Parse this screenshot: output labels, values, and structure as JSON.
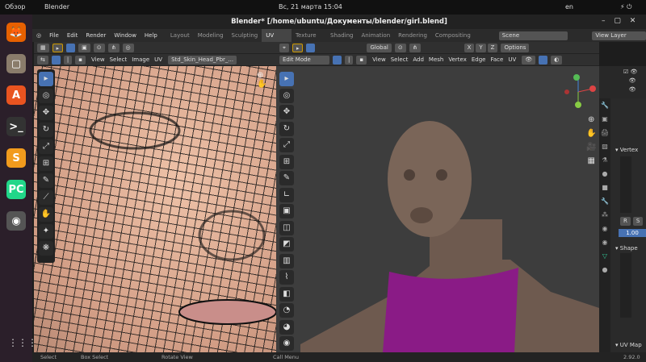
{
  "topbar": {
    "overview": "Обзор",
    "app": "Blender",
    "clock": "Вс, 21 марта  15:04",
    "lang": "en"
  },
  "dock": [
    {
      "name": "firefox",
      "glyph": "🦊",
      "color": "#e66000"
    },
    {
      "name": "files",
      "glyph": "▢",
      "color": "#8a7c6b"
    },
    {
      "name": "software",
      "glyph": "A",
      "color": "#e95420"
    },
    {
      "name": "terminal",
      "glyph": ">_",
      "color": "#333"
    },
    {
      "name": "sublime",
      "glyph": "S",
      "color": "#f29b1d"
    },
    {
      "name": "pycharm",
      "glyph": "PC",
      "color": "#21d789"
    },
    {
      "name": "blender",
      "glyph": "◉",
      "color": "#555"
    }
  ],
  "window_title": "Blender* [/home/ubuntu/Документы/blender/girl.blend]",
  "menu": [
    "File",
    "Edit",
    "Render",
    "Window",
    "Help"
  ],
  "workspaces": [
    "Layout",
    "Modeling",
    "Sculpting",
    "UV Editing",
    "Texture Paint",
    "Shading",
    "Animation",
    "Rendering",
    "Compositing"
  ],
  "active_workspace": "UV Editing",
  "scene": "Scene",
  "view_layer": "View Layer",
  "uv_header": {
    "menus": [
      "View",
      "Select",
      "Image",
      "UV"
    ],
    "image": "Std_Skin_Head_Pbr_..."
  },
  "vp_header": {
    "orientation": "Global",
    "options": "Options",
    "mode": "Edit Mode",
    "menus": [
      "View",
      "Select",
      "Add",
      "Mesh",
      "Vertex",
      "Edge",
      "Face",
      "UV"
    ],
    "axes": [
      "X",
      "Y",
      "Z"
    ]
  },
  "props": {
    "vertex_groups": "Vertex",
    "r": "R",
    "s": "S",
    "value": "1.00",
    "shape_keys": "Shape",
    "uv_maps": "UV Map"
  },
  "status": {
    "select": "Select",
    "box_select": "Box Select",
    "rotate": "Rotate View",
    "call_menu": "Call Menu",
    "version": "2.92.0"
  },
  "gizmo": {
    "x": "X",
    "y": "Y",
    "z": "Z"
  }
}
